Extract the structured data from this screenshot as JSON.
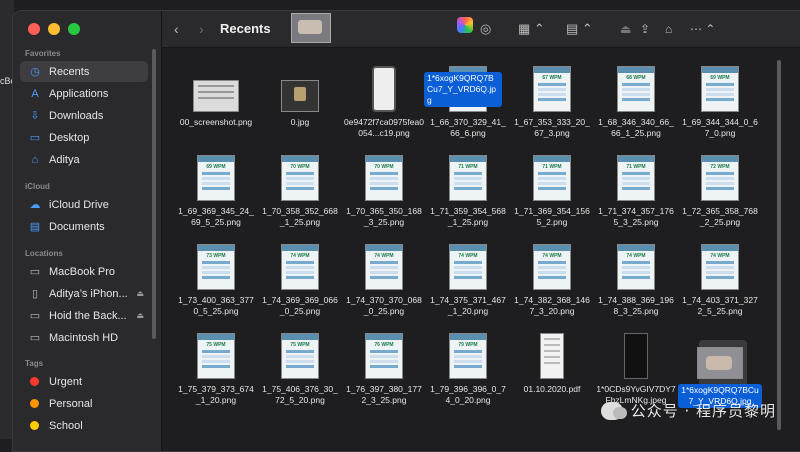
{
  "desktop_fragment": "cBo",
  "window": {
    "title": "Recents",
    "controls": [
      "red",
      "yellow",
      "green"
    ]
  },
  "sidebar": {
    "sections": [
      {
        "name": "Favorites",
        "items": [
          {
            "label": "Recents",
            "icon": "clock-icon",
            "selected": true
          },
          {
            "label": "Applications",
            "icon": "applications-icon"
          },
          {
            "label": "Downloads",
            "icon": "download-icon"
          },
          {
            "label": "Desktop",
            "icon": "desktop-icon"
          },
          {
            "label": "Aditya",
            "icon": "home-icon"
          }
        ]
      },
      {
        "name": "iCloud",
        "items": [
          {
            "label": "iCloud Drive",
            "icon": "cloud-icon"
          },
          {
            "label": "Documents",
            "icon": "document-icon"
          }
        ]
      },
      {
        "name": "Locations",
        "items": [
          {
            "label": "MacBook Pro",
            "icon": "laptop-icon"
          },
          {
            "label": "Aditya’s iPhon...",
            "icon": "phone-icon",
            "eject": true
          },
          {
            "label": "Hoid the Back...",
            "icon": "drive-icon",
            "eject": true
          },
          {
            "label": "Macintosh HD",
            "icon": "disk-icon"
          }
        ]
      },
      {
        "name": "Tags",
        "items": [
          {
            "label": "Urgent",
            "color": "#ff3b30"
          },
          {
            "label": "Personal",
            "color": "#ff9500"
          },
          {
            "label": "School",
            "color": "#ffcc00"
          }
        ]
      }
    ]
  },
  "toolbar": {
    "back": "‹",
    "forward": "›",
    "drag_label": "1*6xogK9QRQ7BCu7_Y_VRD6Q.jpg"
  },
  "files": [
    {
      "name": "00_screenshot.png",
      "kind": "wide"
    },
    {
      "name": "0.jpg",
      "kind": "cube"
    },
    {
      "name": "0e9472f7ca0975fea0054...c19.png",
      "kind": "phone"
    },
    {
      "name": "1_66_370_329_41_66_6.png",
      "kind": "wpm",
      "wpm": "66 WPM"
    },
    {
      "name": "1_67_353_333_20_67_3.png",
      "kind": "wpm",
      "wpm": "67 WPM"
    },
    {
      "name": "1_68_346_340_66_66_1_25.png",
      "kind": "wpm",
      "wpm": "68 WPM"
    },
    {
      "name": "1_69_344_344_0_67_0.png",
      "kind": "wpm",
      "wpm": "69 WPM"
    },
    {
      "name": "1_69_369_345_24_69_5_25.png",
      "kind": "wpm",
      "wpm": "69 WPM"
    },
    {
      "name": "1_70_358_352_668_1_25.png",
      "kind": "wpm",
      "wpm": "70 WPM"
    },
    {
      "name": "1_70_365_350_168_3_25.png",
      "kind": "wpm",
      "wpm": "70 WPM"
    },
    {
      "name": "1_71_359_354_568_1_25.png",
      "kind": "wpm",
      "wpm": "71 WPM"
    },
    {
      "name": "1_71_369_354_1565_2.png",
      "kind": "wpm",
      "wpm": "71 WPM"
    },
    {
      "name": "1_71_374_357_1765_3_25.png",
      "kind": "wpm",
      "wpm": "71 WPM"
    },
    {
      "name": "1_72_365_358_768_2_25.png",
      "kind": "wpm",
      "wpm": "72 WPM"
    },
    {
      "name": "1_73_400_363_3770_5_25.png",
      "kind": "wpm",
      "wpm": "73 WPM"
    },
    {
      "name": "1_74_369_369_066_0_25.png",
      "kind": "wpm",
      "wpm": "74 WPM"
    },
    {
      "name": "1_74_370_370_068_0_25.png",
      "kind": "wpm",
      "wpm": "74 WPM"
    },
    {
      "name": "1_74_375_371_467_1_20.png",
      "kind": "wpm",
      "wpm": "74 WPM"
    },
    {
      "name": "1_74_382_368_1467_3_20.png",
      "kind": "wpm",
      "wpm": "74 WPM"
    },
    {
      "name": "1_74_388_369_1968_3_25.png",
      "kind": "wpm",
      "wpm": "74 WPM"
    },
    {
      "name": "1_74_403_371_3272_5_25.png",
      "kind": "wpm",
      "wpm": "74 WPM"
    },
    {
      "name": "1_75_379_373_674_1_20.png",
      "kind": "wpm",
      "wpm": "75 WPM"
    },
    {
      "name": "1_75_406_376_30_72_5_20.png",
      "kind": "wpm",
      "wpm": "75 WPM"
    },
    {
      "name": "1_76_397_380_1772_3_25.png",
      "kind": "wpm",
      "wpm": "76 WPM"
    },
    {
      "name": "1_79_396_396_0_74_0_20.png",
      "kind": "wpm",
      "wpm": "79 WPM"
    },
    {
      "name": "01.10.2020.pdf",
      "kind": "doc"
    },
    {
      "name": "1*0CDs9YvGIV7DY7FbzLmNKg.jpeg",
      "kind": "dark"
    },
    {
      "name": "1*6xogK9QRQ7BCu7_Y_VRD6Q.jpg",
      "kind": "hand",
      "selected": true
    }
  ],
  "watermark": "公众号 · 程序员黎明"
}
